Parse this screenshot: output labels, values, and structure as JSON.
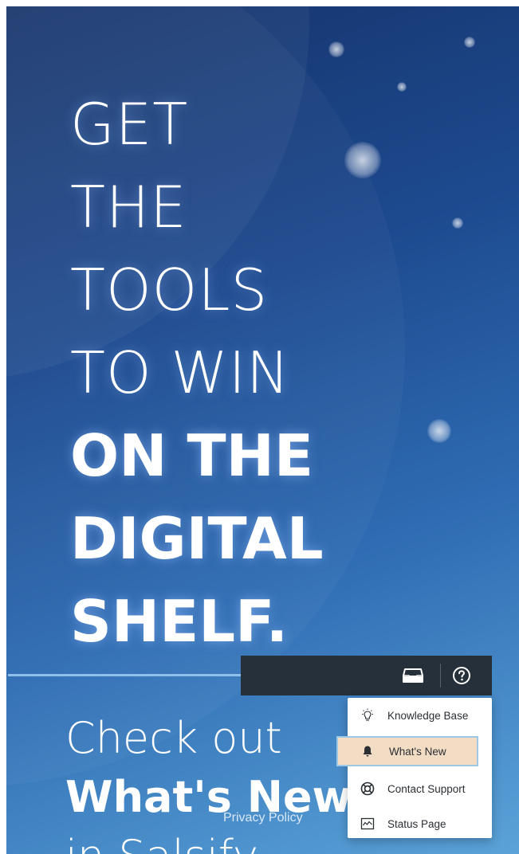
{
  "headline": {
    "line1": "GET",
    "line2": "THE",
    "line3": "TOOLS",
    "line4": "TO WIN",
    "line5": "ON THE",
    "line6": "DIGITAL",
    "line7": "SHELF."
  },
  "subheadline": {
    "line1": "Check out",
    "line2": "What's New",
    "line3": "in Salsify"
  },
  "footer": {
    "privacy_link": "Privacy Policy"
  },
  "topbar": {
    "icons": [
      "inbox-icon",
      "help-icon"
    ]
  },
  "help_menu": {
    "items": [
      {
        "label": "Knowledge Base",
        "icon": "lightbulb-icon"
      },
      {
        "label": "What's New",
        "icon": "bell-icon",
        "highlighted": true
      },
      {
        "label": "Contact Support",
        "icon": "lifebuoy-icon"
      },
      {
        "label": "Status Page",
        "icon": "activity-icon"
      }
    ]
  },
  "colors": {
    "background_top": "#16336a",
    "background_bottom": "#5aa3d8",
    "topbar": "#25303a",
    "highlight": "#f3dcc4",
    "highlight_border": "#9fc7e6",
    "divider": "#8fc0ec"
  }
}
